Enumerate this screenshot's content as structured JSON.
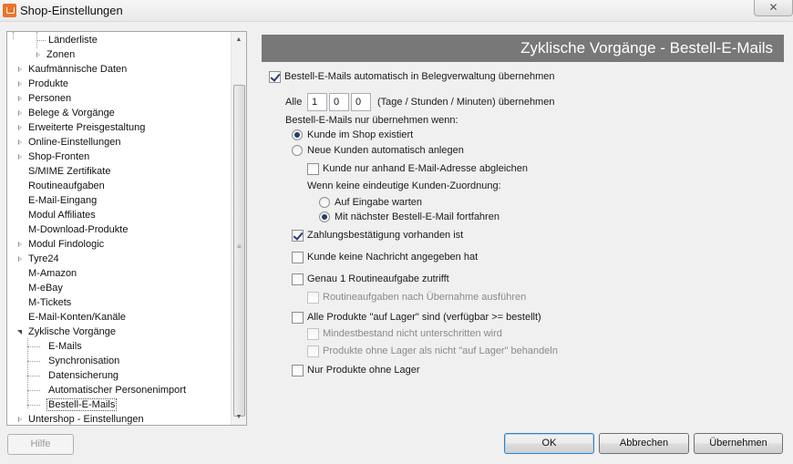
{
  "window": {
    "title": "Shop-Einstellungen",
    "close_label": "✕"
  },
  "tree": {
    "items": [
      {
        "label": "Länderliste"
      },
      {
        "label": "Zonen"
      },
      {
        "label": "Kaufmännische Daten"
      },
      {
        "label": "Produkte"
      },
      {
        "label": "Personen"
      },
      {
        "label": "Belege & Vorgänge"
      },
      {
        "label": "Erweiterte Preisgestaltung"
      },
      {
        "label": "Online-Einstellungen"
      },
      {
        "label": "Shop-Fronten"
      },
      {
        "label": "S/MIME Zertifikate"
      },
      {
        "label": "Routineaufgaben"
      },
      {
        "label": "E-Mail-Eingang"
      },
      {
        "label": "Modul Affiliates"
      },
      {
        "label": "M-Download-Produkte"
      },
      {
        "label": "Modul Findologic"
      },
      {
        "label": "Tyre24"
      },
      {
        "label": "M-Amazon"
      },
      {
        "label": "M-eBay"
      },
      {
        "label": "M-Tickets"
      },
      {
        "label": "E-Mail-Konten/Kanäle"
      },
      {
        "label": "Zyklische Vorgänge"
      },
      {
        "label": "E-Mails"
      },
      {
        "label": "Synchronisation"
      },
      {
        "label": "Datensicherung"
      },
      {
        "label": "Automatischer Personenimport"
      },
      {
        "label": "Bestell-E-Mails"
      },
      {
        "label": "Untershop - Einstellungen"
      }
    ],
    "scroll_up": "▲",
    "scroll_down": "▼",
    "grip": "≡"
  },
  "content": {
    "header": "Zyklische Vorgänge - Bestell-E-Mails",
    "auto_import_label": "Bestell-E-Mails automatisch in Belegverwaltung übernehmen",
    "interval_prefix": "Alle",
    "interval_days": "1",
    "interval_hours": "0",
    "interval_minutes": "0",
    "interval_suffix": "(Tage / Stunden / Minuten) übernehmen",
    "condition_heading": "Bestell-E-Mails nur übernehmen wenn:",
    "radio_customer_exists": "Kunde im Shop existiert",
    "radio_new_customer": "Neue Kunden automatisch anlegen",
    "match_email_only": "Kunde nur anhand E-Mail-Adresse abgleichen",
    "no_match_heading": "Wenn keine eindeutige Kunden-Zuordnung:",
    "radio_wait_input": "Auf Eingabe warten",
    "radio_next_email": "Mit nächster Bestell-E-Mail fortfahren",
    "payment_confirmation": "Zahlungsbestätigung vorhanden ist",
    "no_message": "Kunde keine Nachricht angegeben hat",
    "one_routine": "Genau 1 Routineaufgabe zutrifft",
    "run_routines": "Routineaufgaben nach Übernahme ausführen",
    "all_in_stock": "Alle Produkte \"auf Lager\" sind (verfügbar >= bestellt)",
    "min_stock": "Mindestbestand nicht unterschritten wird",
    "no_stock_products": "Produkte ohne Lager als nicht \"auf Lager\" behandeln",
    "only_no_stock": "Nur Produkte ohne Lager"
  },
  "buttons": {
    "help": "Hilfe",
    "ok": "OK",
    "cancel": "Abbrechen",
    "apply": "Übernehmen"
  }
}
